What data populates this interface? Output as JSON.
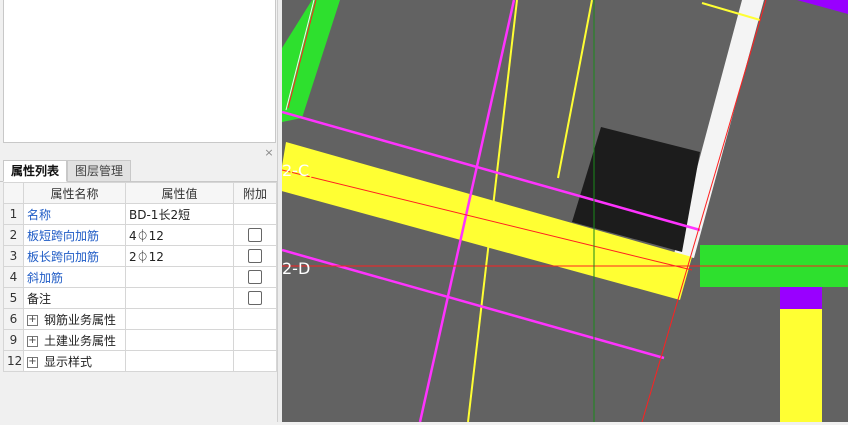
{
  "panel": {
    "close_glyph": "×",
    "tabs": [
      {
        "label": "属性列表",
        "active": true
      },
      {
        "label": "图层管理",
        "active": false
      }
    ],
    "table": {
      "headers": {
        "num": "",
        "name": "属性名称",
        "value": "属性值",
        "extra": "附加"
      },
      "rows": [
        {
          "num": "1",
          "name": "名称",
          "value": "BD-1长2短",
          "checkbox": false,
          "blue": true
        },
        {
          "num": "2",
          "name": "板短跨向加筋",
          "value": "4⏀12",
          "checkbox": true,
          "blue": true
        },
        {
          "num": "3",
          "name": "板长跨向加筋",
          "value": "2⏀12",
          "checkbox": true,
          "blue": true
        },
        {
          "num": "4",
          "name": "斜加筋",
          "value": "",
          "checkbox": true,
          "blue": true
        },
        {
          "num": "5",
          "name": "备注",
          "value": "",
          "checkbox": true,
          "blue": false
        },
        {
          "num": "6",
          "name": "钢筋业务属性",
          "value": "",
          "checkbox": false,
          "blue": false,
          "expand": "+"
        },
        {
          "num": "9",
          "name": "土建业务属性",
          "value": "",
          "checkbox": false,
          "blue": false,
          "expand": "+"
        },
        {
          "num": "12",
          "name": "显示样式",
          "value": "",
          "checkbox": false,
          "blue": false,
          "expand": "+"
        }
      ]
    }
  },
  "viewport": {
    "axis_labels": [
      "2-C",
      "2-D"
    ],
    "colors": {
      "background": "#626262",
      "slab_yellow": "#ffff33",
      "wall_green": "#2ee02e",
      "opening_black": "#1c1c1c",
      "rebar_magenta": "#ff33ff",
      "axis_red": "#ff2020",
      "column_purple": "#9900ff",
      "beam_white": "#f4f4f4",
      "axis_green": "#1a8a1a"
    }
  }
}
